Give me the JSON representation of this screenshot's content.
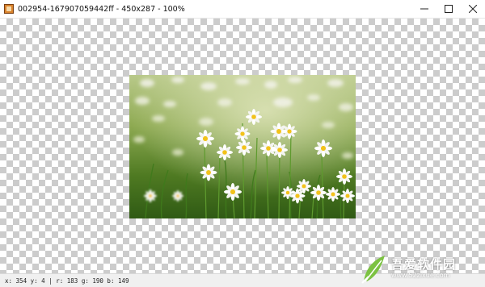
{
  "window": {
    "title": "002954-167907059442ff - 450x287 - 100%",
    "controls": [
      "minimize-icon",
      "maximize-icon",
      "close-icon"
    ]
  },
  "canvas": {
    "background": "transparency-checkerboard",
    "checker_colors": [
      "#ffffff",
      "#cccccc"
    ]
  },
  "image": {
    "description_icon": "daisy-photo"
  },
  "statusbar": {
    "text": "x: 354 y: 4 | r: 183 g: 190 b: 149"
  },
  "watermark": {
    "title": "吾爱软件园",
    "url": "www.52zixue.com",
    "accent": "#7cc242"
  }
}
